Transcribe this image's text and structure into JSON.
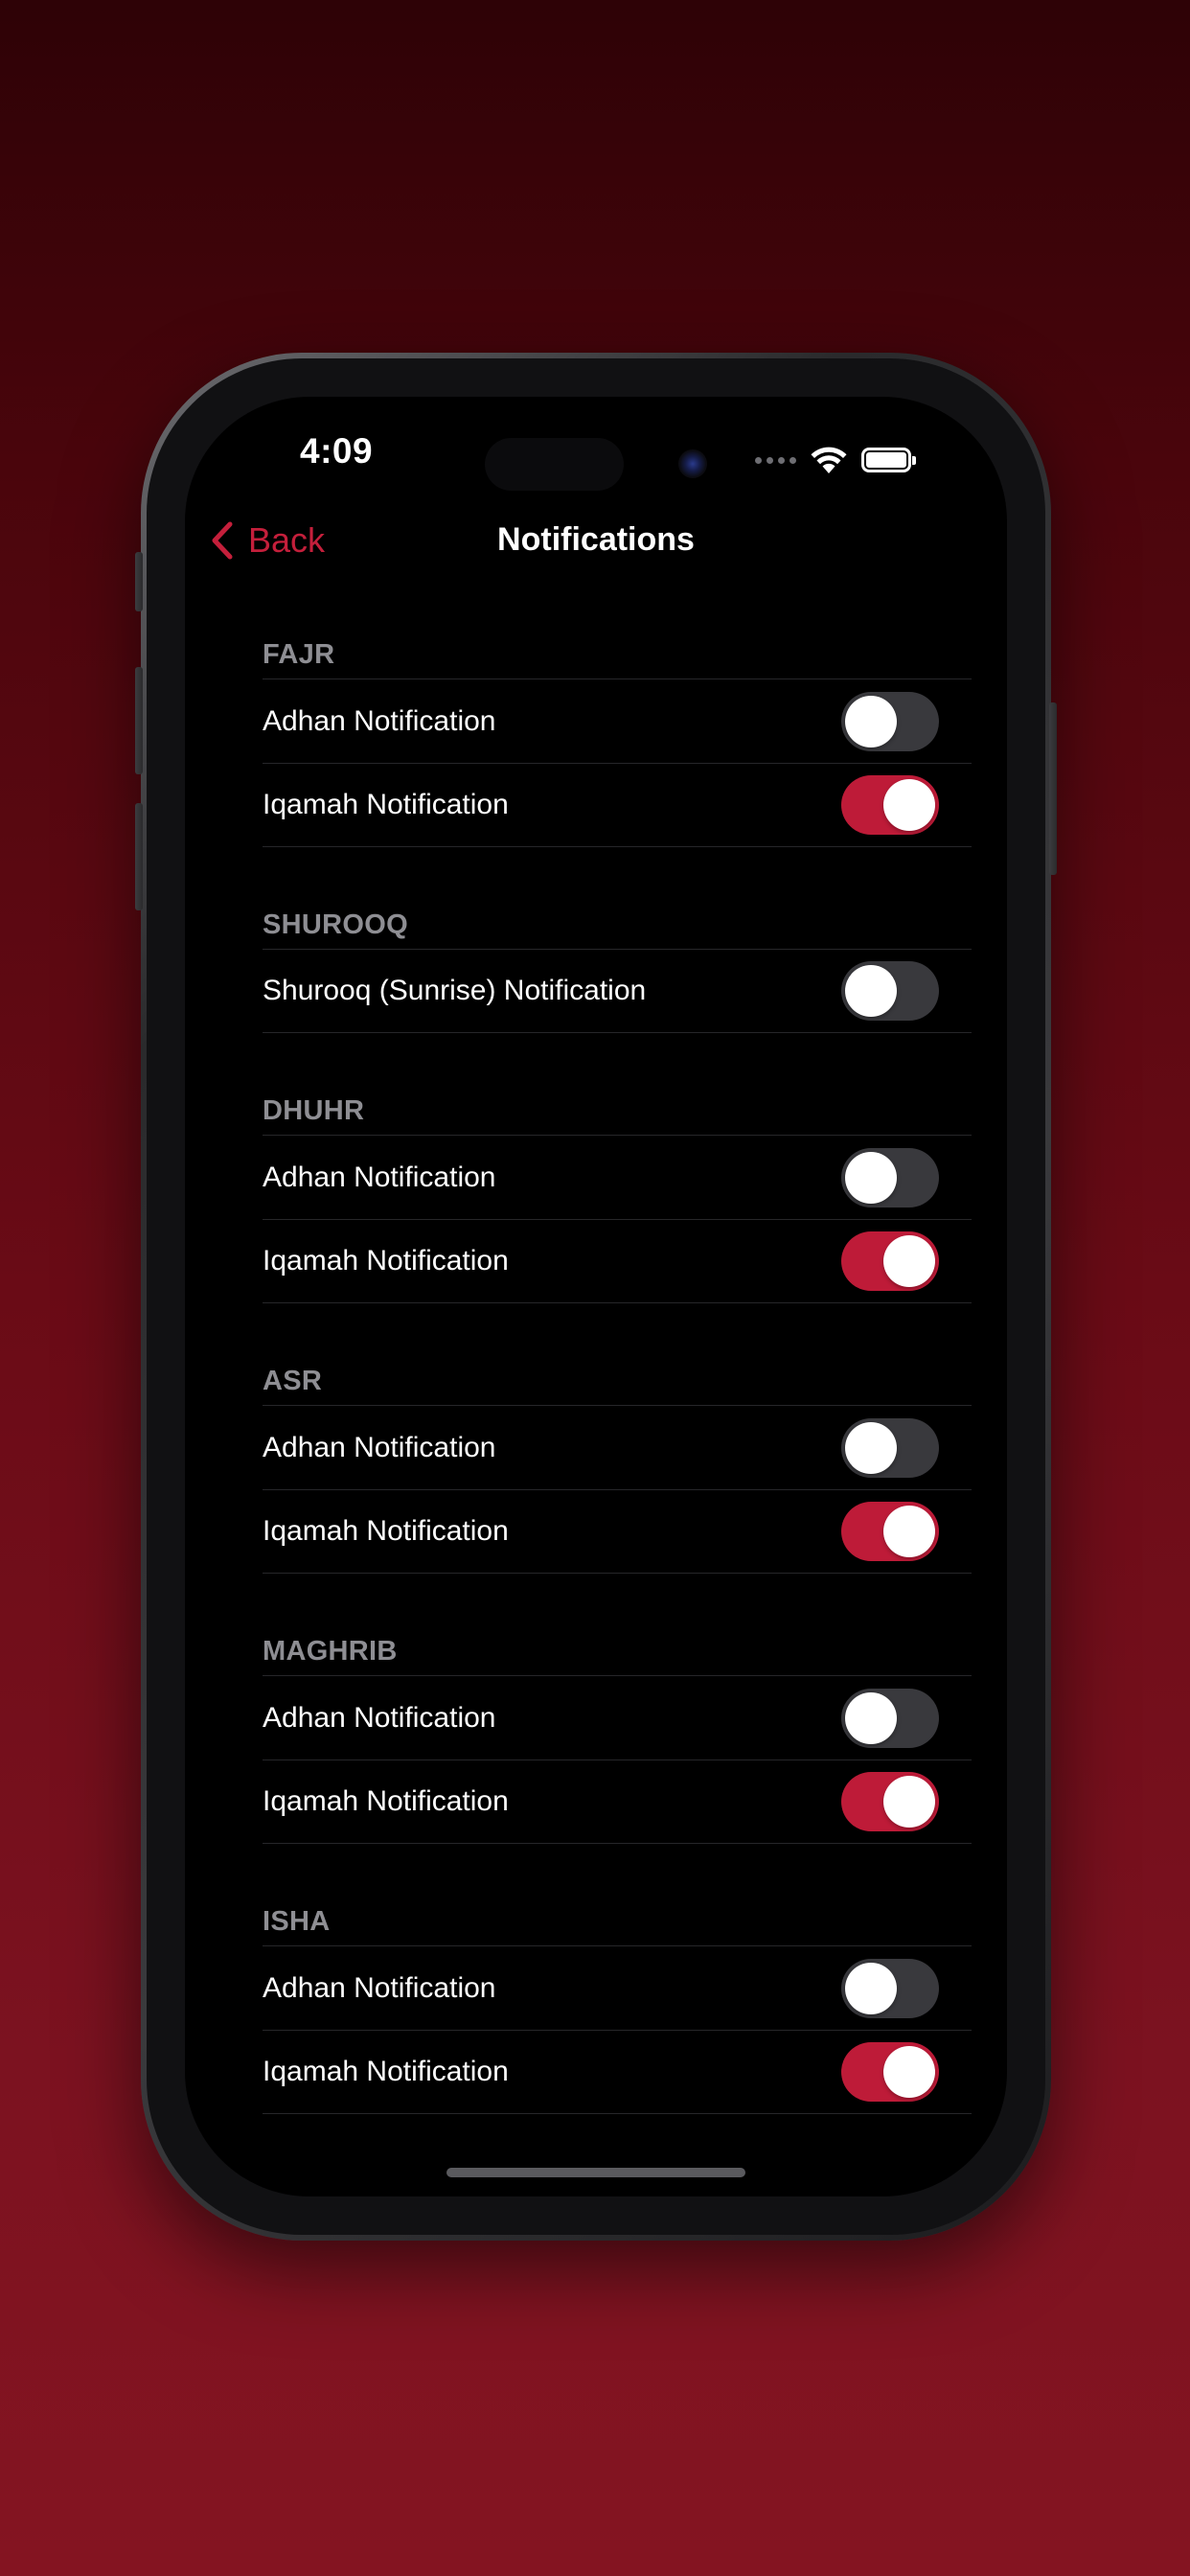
{
  "status_bar": {
    "time": "4:09"
  },
  "nav": {
    "back_label": "Back",
    "title": "Notifications"
  },
  "colors": {
    "accent": "#c41f3b",
    "toggle_on": "#be1b38",
    "toggle_off": "#39393d",
    "section_header": "#8e8e93"
  },
  "sections": [
    {
      "title": "FAJR",
      "rows": [
        {
          "label": "Adhan Notification",
          "on": false
        },
        {
          "label": "Iqamah Notification",
          "on": true
        }
      ]
    },
    {
      "title": "SHUROOQ",
      "rows": [
        {
          "label": "Shurooq (Sunrise) Notification",
          "on": false
        }
      ]
    },
    {
      "title": "DHUHR",
      "rows": [
        {
          "label": "Adhan Notification",
          "on": false
        },
        {
          "label": "Iqamah Notification",
          "on": true
        }
      ]
    },
    {
      "title": "ASR",
      "rows": [
        {
          "label": "Adhan Notification",
          "on": false
        },
        {
          "label": "Iqamah Notification",
          "on": true
        }
      ]
    },
    {
      "title": "MAGHRIB",
      "rows": [
        {
          "label": "Adhan Notification",
          "on": false
        },
        {
          "label": "Iqamah Notification",
          "on": true
        }
      ]
    },
    {
      "title": "ISHA",
      "rows": [
        {
          "label": "Adhan Notification",
          "on": false
        },
        {
          "label": "Iqamah Notification",
          "on": true
        }
      ]
    }
  ]
}
